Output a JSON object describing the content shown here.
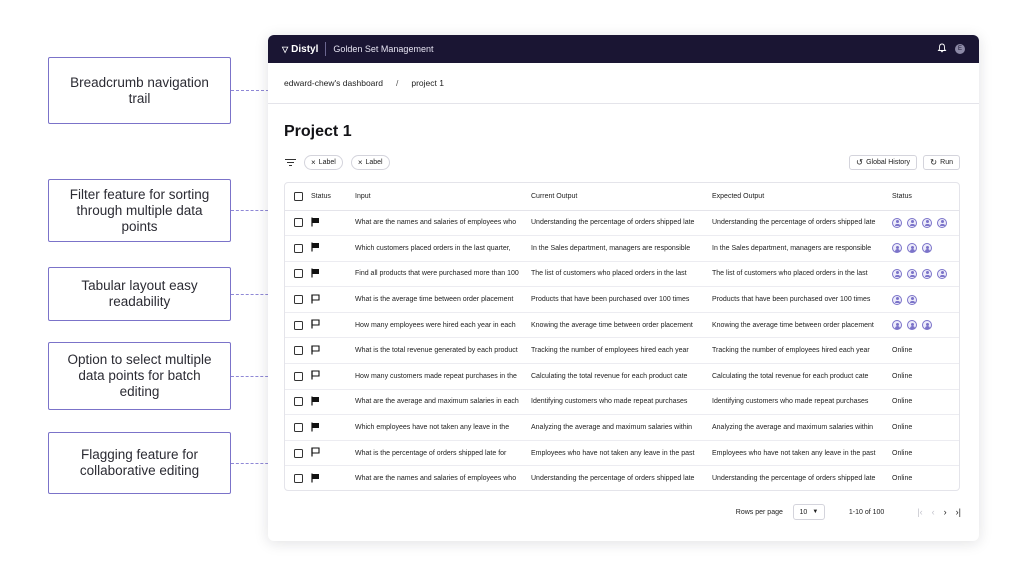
{
  "callouts": [
    "Breadcrumb navigation trail",
    "Filter feature for sorting through multiple data points",
    "Tabular layout easy readability",
    "Option to select multiple data points for batch editing",
    "Flagging feature for collaborative editing"
  ],
  "header": {
    "brand": "Distyl",
    "app_name": "Golden Set Management",
    "user_initial": "E",
    "icons": [
      "bell-icon",
      "user-avatar"
    ]
  },
  "breadcrumb": [
    "edward-chew's dashboard",
    "/",
    "project 1"
  ],
  "page_title": "Project 1",
  "filters": [
    "Label",
    "Label"
  ],
  "toolbar": {
    "history_label": "Global History",
    "run_label": "Run"
  },
  "table": {
    "columns": [
      "Status",
      "Input",
      "Current Output",
      "Expected Output",
      "Status"
    ],
    "rows": [
      {
        "flagged": true,
        "input": "What are the names and salaries of employees who",
        "current": "Understanding the percentage of orders shipped late",
        "expected": "Understanding the percentage of orders shipped late",
        "reviewers": 4,
        "status": ""
      },
      {
        "flagged": true,
        "input": "Which customers placed orders in the last quarter,",
        "current": "In the Sales department, managers are responsible",
        "expected": "In the Sales department, managers are responsible",
        "reviewers": 3,
        "status": ""
      },
      {
        "flagged": true,
        "input": "Find all products that were purchased more than 100",
        "current": "The list of customers who placed orders in the last",
        "expected": "The list of customers who placed orders in the last",
        "reviewers": 4,
        "status": ""
      },
      {
        "flagged": false,
        "input": "What is the average time between order placement",
        "current": "Products that have been purchased over 100 times",
        "expected": "Products that have been purchased over 100 times",
        "reviewers": 2,
        "status": ""
      },
      {
        "flagged": false,
        "input": "How many employees were hired each year in each",
        "current": "Knowing the average time between order placement",
        "expected": "Knowing the average time between order placement",
        "reviewers": 3,
        "status": ""
      },
      {
        "flagged": false,
        "input": "What is the total revenue generated by each product",
        "current": "Tracking the number of employees hired each year",
        "expected": "Tracking the number of employees hired each year",
        "reviewers": 0,
        "status": "Online"
      },
      {
        "flagged": false,
        "input": "How many customers made repeat purchases in the",
        "current": "Calculating the total revenue for each product cate",
        "expected": "Calculating the total revenue for each product cate",
        "reviewers": 0,
        "status": "Online"
      },
      {
        "flagged": true,
        "input": "What are the average and maximum salaries in each",
        "current": "Identifying customers who made repeat purchases",
        "expected": "Identifying customers who made repeat purchases",
        "reviewers": 0,
        "status": "Online"
      },
      {
        "flagged": true,
        "input": "Which employees have not taken any leave in the",
        "current": "Analyzing the average and maximum salaries within",
        "expected": "Analyzing the average and maximum salaries within",
        "reviewers": 0,
        "status": "Online"
      },
      {
        "flagged": false,
        "input": "What is the percentage of orders shipped late for",
        "current": "Employees who have not taken any leave in the past",
        "expected": "Employees who have not taken any leave in the past",
        "reviewers": 0,
        "status": "Online"
      },
      {
        "flagged": true,
        "input": "What are the names and salaries of employees who",
        "current": "Understanding the percentage of orders shipped late",
        "expected": "Understanding the percentage of orders shipped late",
        "reviewers": 0,
        "status": "Online"
      }
    ]
  },
  "pagination": {
    "rows_label": "Rows per page",
    "rows_value": "10",
    "range": "1-10 of 100"
  },
  "colors": {
    "nav_bg": "#1a1533",
    "accent": "#5b53d6",
    "callout_border": "#7b73c9"
  }
}
